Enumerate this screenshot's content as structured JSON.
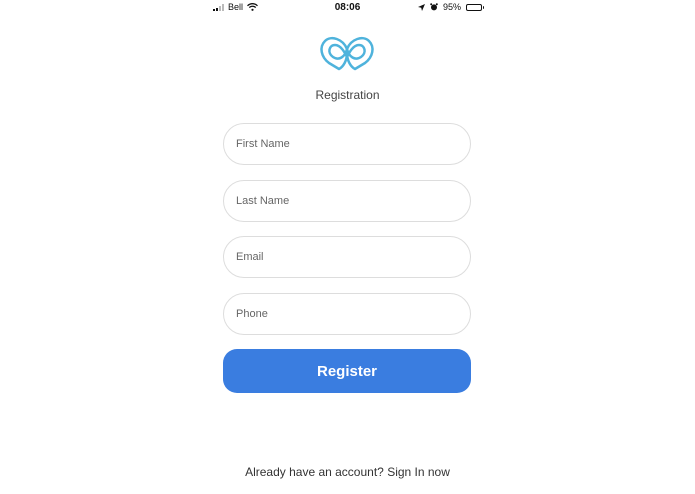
{
  "status_bar": {
    "carrier": "Bell",
    "time": "08:06",
    "battery_percent": "95%",
    "battery_level": 0.95,
    "icons": [
      "signal-icon",
      "wifi-icon",
      "location-icon",
      "alarm-icon",
      "battery-icon"
    ]
  },
  "header": {
    "logo_icon": "infinity-heart-logo",
    "title": "Registration"
  },
  "form": {
    "first_name_placeholder": "First Name",
    "last_name_placeholder": "Last Name",
    "email_placeholder": "Email",
    "phone_placeholder": "Phone",
    "register_label": "Register"
  },
  "footer": {
    "prompt": "Already have an account?",
    "sign_in_link": "Sign In now"
  },
  "colors": {
    "accent": "#3a7de0",
    "logo": "#4fb3dc",
    "field_border": "#dddddd"
  }
}
